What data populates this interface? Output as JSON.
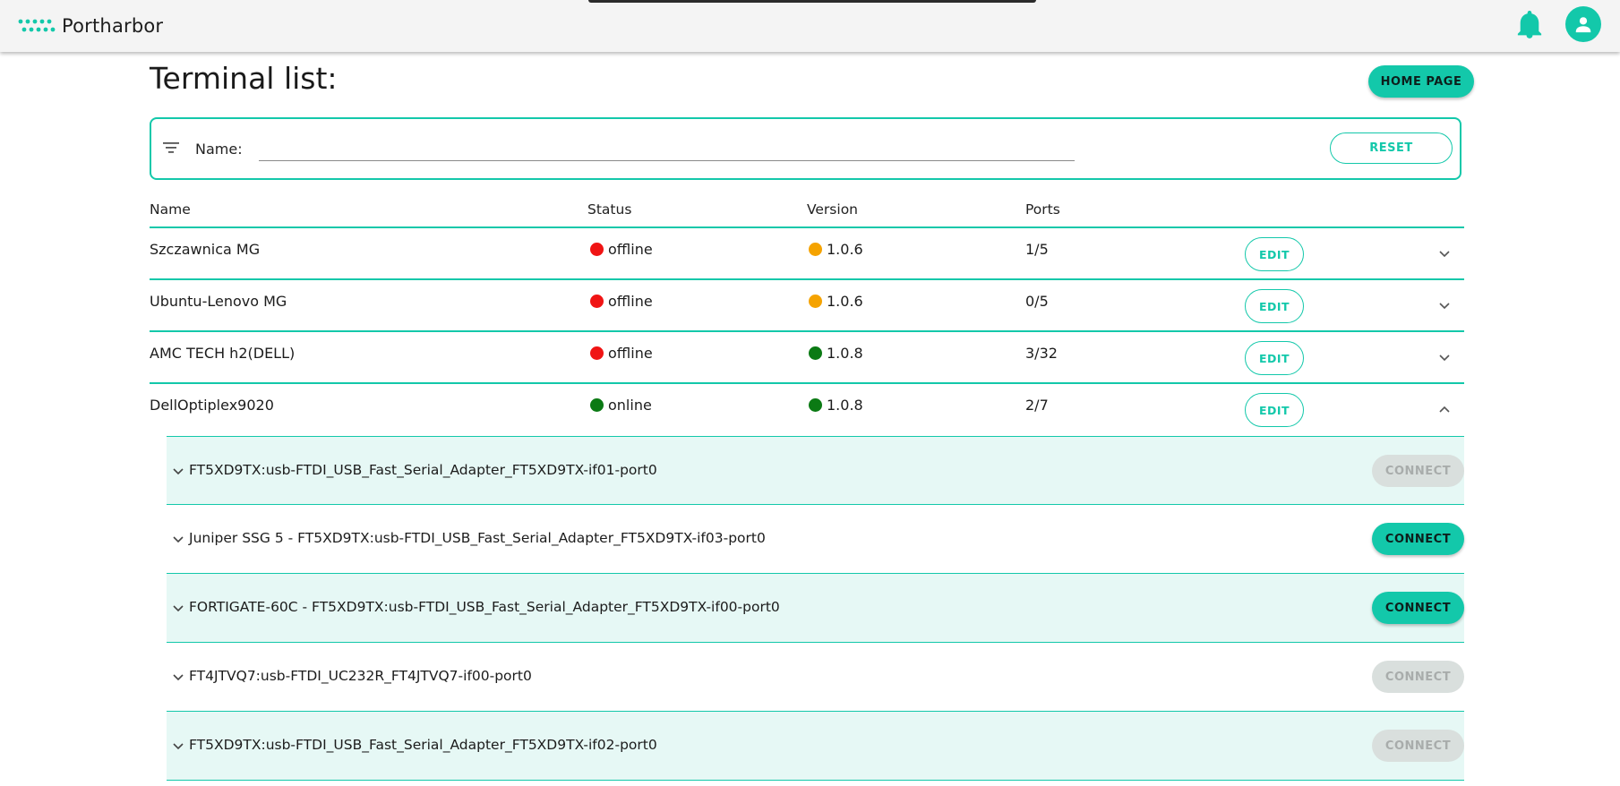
{
  "app": {
    "name": "Portharbor"
  },
  "page": {
    "title": "Terminal list:",
    "home_button": "HOME PAGE"
  },
  "filter": {
    "label": "Name:",
    "value": "",
    "reset_button": "RESET"
  },
  "table": {
    "headers": [
      "Name",
      "Status",
      "Version",
      "Ports"
    ],
    "rows": [
      {
        "name": "Szczawnica MG",
        "status": "offline",
        "status_color": "#f01414",
        "version": "1.0.6",
        "version_color": "#f5a300",
        "ports": "1/5",
        "edit": "EDIT",
        "expanded": false
      },
      {
        "name": "Ubuntu-Lenovo MG",
        "status": "offline",
        "status_color": "#f01414",
        "version": "1.0.6",
        "version_color": "#f5a300",
        "ports": "0/5",
        "edit": "EDIT",
        "expanded": false
      },
      {
        "name": "AMC TECH h2(DELL)",
        "status": "offline",
        "status_color": "#f01414",
        "version": "1.0.8",
        "version_color": "#0b7a14",
        "ports": "3/32",
        "edit": "EDIT",
        "expanded": false
      },
      {
        "name": "DellOptiplex9020",
        "status": "online",
        "status_color": "#0b7a14",
        "version": "1.0.8",
        "version_color": "#0b7a14",
        "ports": "2/7",
        "edit": "EDIT",
        "expanded": true
      }
    ]
  },
  "ports": [
    {
      "label": "FT5XD9TX:usb-FTDI_USB_Fast_Serial_Adapter_FT5XD9TX-if01-port0",
      "button": "CONNECT",
      "enabled": false
    },
    {
      "label": "Juniper SSG 5 - FT5XD9TX:usb-FTDI_USB_Fast_Serial_Adapter_FT5XD9TX-if03-port0",
      "button": "CONNECT",
      "enabled": true
    },
    {
      "label": "FORTIGATE-60C - FT5XD9TX:usb-FTDI_USB_Fast_Serial_Adapter_FT5XD9TX-if00-port0",
      "button": "CONNECT",
      "enabled": true
    },
    {
      "label": "FT4JTVQ7:usb-FTDI_UC232R_FT4JTVQ7-if00-port0",
      "button": "CONNECT",
      "enabled": false
    },
    {
      "label": "FT5XD9TX:usb-FTDI_USB_Fast_Serial_Adapter_FT5XD9TX-if02-port0",
      "button": "CONNECT",
      "enabled": false
    }
  ],
  "colors": {
    "accent": "#13c8aa",
    "row_highlight": "#e6f8f5"
  },
  "icons": {
    "logo": "logo-dots-icon",
    "notifications": "bell-icon",
    "account": "account-icon",
    "filter": "filter-icon",
    "collapse": "chevron-down-icon",
    "expand": "chevron-up-icon"
  }
}
